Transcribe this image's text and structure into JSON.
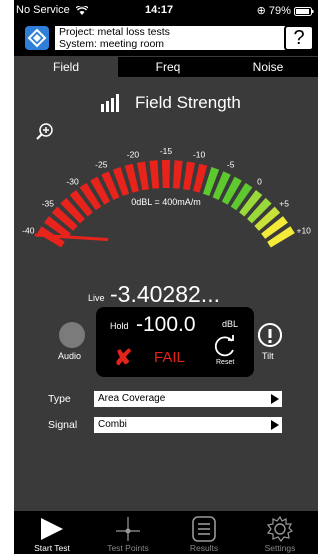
{
  "status": {
    "carrier": "No Service",
    "time": "14:17",
    "battery": "79%"
  },
  "project": {
    "line1": "Project: metal loss tests",
    "line2": "System: meeting room",
    "help": "?"
  },
  "tabs": [
    {
      "label": "Field",
      "active": true
    },
    {
      "label": "Freq",
      "active": false
    },
    {
      "label": "Noise",
      "active": false
    }
  ],
  "title": "Field Strength",
  "gauge": {
    "ticks": [
      "-40",
      "-35",
      "-30",
      "-25",
      "-20",
      "-15",
      "-10",
      "-5",
      "0",
      "+5",
      "+10"
    ],
    "reference": "0dBL = 400mA/m",
    "needle_value": -40,
    "colors": {
      "red": "#e8231c",
      "green": "#5ec92e",
      "lime": "#9ad93a",
      "yellow": "#f3ea3a"
    }
  },
  "live": {
    "label": "Live",
    "value": "-3.40282..."
  },
  "audio": {
    "label": "Audio"
  },
  "hold": {
    "label": "Hold",
    "value": "-100.0",
    "unit": "dBL",
    "status": "FAIL",
    "reset": "Reset"
  },
  "tilt": {
    "label": "Tilt"
  },
  "type": {
    "label": "Type",
    "value": "Area Coverage"
  },
  "signal": {
    "label": "Signal",
    "value": "Combi"
  },
  "nav": [
    {
      "label": "Start Test",
      "icon": "play-icon",
      "active": true
    },
    {
      "label": "Test Points",
      "icon": "crosshair-icon",
      "active": false
    },
    {
      "label": "Results",
      "icon": "list-icon",
      "active": false
    },
    {
      "label": "Settings",
      "icon": "gear-icon",
      "active": false
    }
  ]
}
